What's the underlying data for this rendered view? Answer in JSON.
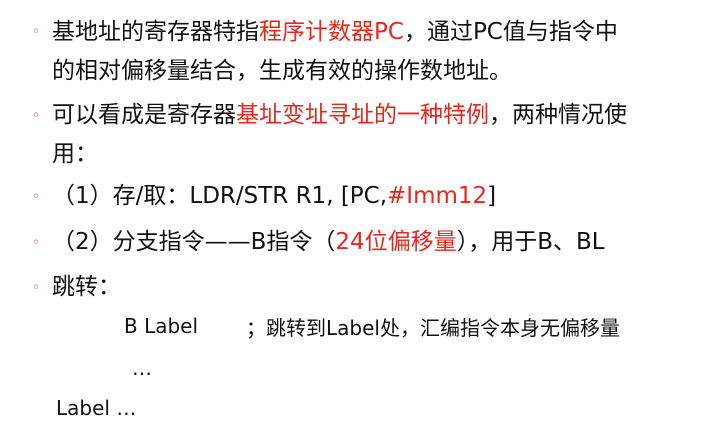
{
  "slide": {
    "bullet_symbol": "◦",
    "accent_color": "#e8261c",
    "bullet_color": "#c0504d",
    "bullets": [
      {
        "line1": {
          "before": "基地址的寄存器特指",
          "red": "程序计数器PC",
          "after": "，通过PC值与指令中"
        },
        "line2": "的相对偏移量结合，生成有效的操作数地址。"
      },
      {
        "line1": {
          "before": "可以看成是寄存器",
          "red": "基址变址寻址的一种特例",
          "after": "，两种情况使"
        },
        "line2": "用："
      },
      {
        "line1": {
          "before": "（1）存/取：LDR/STR R1, [PC,",
          "red": "#Imm12",
          "after": "]"
        }
      },
      {
        "line1": {
          "before": "（2）分支指令——B指令（",
          "red": "24位偏移量",
          "after": "），用于B、BL"
        }
      },
      {
        "line1": {
          "before": "跳转：",
          "red": "",
          "after": ""
        }
      }
    ],
    "code": {
      "line1_instr": "B Label",
      "line1_comment": "；跳转到Label处，汇编指令本身无偏移量",
      "line2": "…",
      "line3": "Label …"
    }
  }
}
